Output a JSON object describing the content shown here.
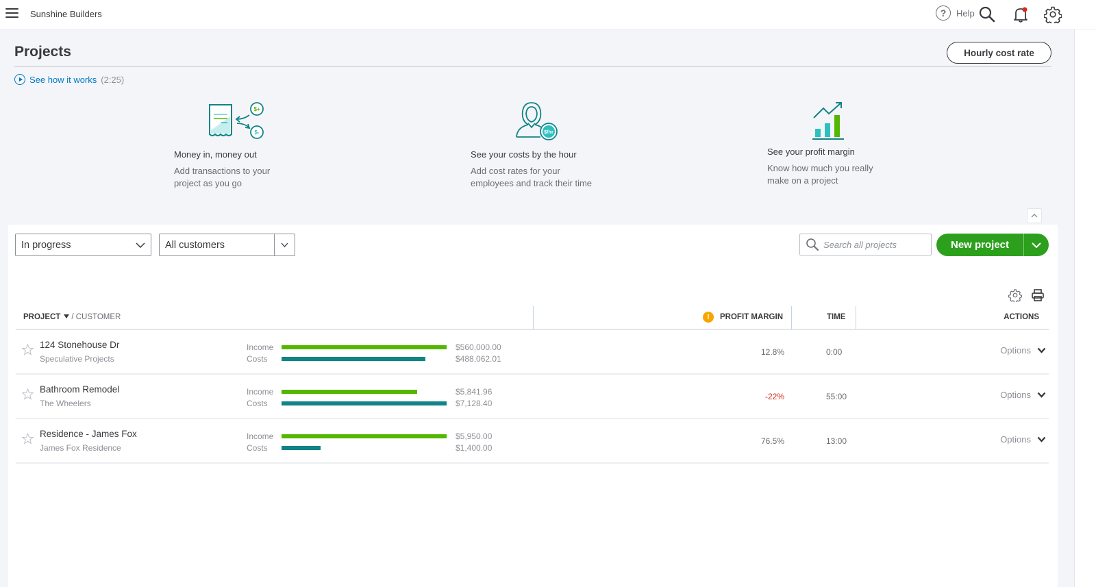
{
  "topbar": {
    "company_name": "Sunshine Builders",
    "help_label": "Help",
    "help_glyph": "?",
    "icons": [
      "menu-icon",
      "help-icon",
      "search-icon",
      "notification-bell-icon",
      "settings-gear-icon"
    ],
    "notification_badge_color": "#d52b1e"
  },
  "page": {
    "title": "Projects",
    "hourly_cost_rate_label": "Hourly cost rate",
    "see_how_label": "See how it works",
    "see_how_duration": "(2:25)"
  },
  "features": [
    {
      "icon": "money-in-out-icon",
      "title": "Money in, money out",
      "desc_line1": "Add transactions to your",
      "desc_line2": "project as you go",
      "icon_text_plus": "$+",
      "icon_text_minus": "$-"
    },
    {
      "icon": "cost-by-hour-icon",
      "title": "See your costs by the hour",
      "desc_line1": "Add cost rates for your",
      "desc_line2": "employees and track their time",
      "icon_text": "$/hr"
    },
    {
      "icon": "profit-margin-icon",
      "title": "See your profit margin",
      "desc_line1": "Know how much you really",
      "desc_line2": "make on a project"
    }
  ],
  "filters": {
    "status_selected": "In progress",
    "customer_selected": "All customers",
    "search_placeholder": "Search all projects",
    "new_project_label": "New project"
  },
  "table": {
    "headers": {
      "project": "PROJECT",
      "customer": "/ CUSTOMER",
      "profit_margin": "PROFIT MARGIN",
      "profit_warning_glyph": "!",
      "time": "TIME",
      "actions": "ACTIONS"
    },
    "income_label": "Income",
    "costs_label": "Costs",
    "options_label": "Options",
    "rows": [
      {
        "project": "124 Stonehouse Dr",
        "customer": "Speculative Projects",
        "income": "$560,000.00",
        "costs": "$488,062.01",
        "income_value": 560000.0,
        "costs_value": 488062.01,
        "profit_margin": "12.8%",
        "negative": false,
        "time": "0:00",
        "starred": false
      },
      {
        "project": "Bathroom Remodel",
        "customer": "The Wheelers",
        "income": "$5,841.96",
        "costs": "$7,128.40",
        "income_value": 5841.96,
        "costs_value": 7128.4,
        "profit_margin": "-22%",
        "negative": true,
        "time": "55:00",
        "starred": false
      },
      {
        "project": "Residence - James Fox",
        "customer": "James Fox Residence",
        "income": "$5,950.00",
        "costs": "$1,400.00",
        "income_value": 5950.0,
        "costs_value": 1400.0,
        "profit_margin": "76.5%",
        "negative": false,
        "time": "13:00",
        "starred": false
      }
    ]
  },
  "colors": {
    "brand_green": "#2ca01c",
    "income_bar": "#53b700",
    "costs_bar": "#108487",
    "link_blue": "#0077c5",
    "negative_red": "#d52b1e",
    "warning_orange": "#f7a600"
  }
}
